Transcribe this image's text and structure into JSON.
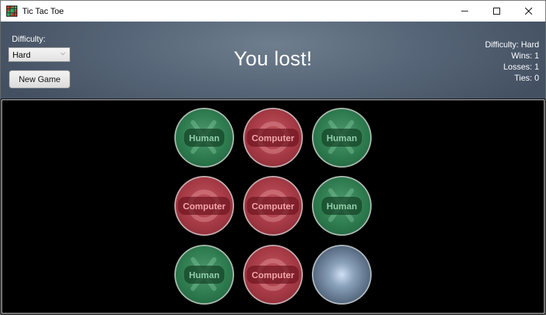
{
  "window": {
    "title": "Tic Tac Toe"
  },
  "header": {
    "difficulty_label": "Difficulty:",
    "difficulty_value": "Hard",
    "new_game_label": "New Game",
    "status_message": "You lost!",
    "stats": {
      "difficulty": "Difficulty: Hard",
      "wins": "Wins: 1",
      "losses": "Losses: 1",
      "ties": "Ties: 0"
    }
  },
  "board": {
    "cells": [
      {
        "owner": "human",
        "label": "Human",
        "mark": "X"
      },
      {
        "owner": "computer",
        "label": "Computer",
        "mark": "O"
      },
      {
        "owner": "human",
        "label": "Human",
        "mark": "X"
      },
      {
        "owner": "computer",
        "label": "Computer",
        "mark": "O"
      },
      {
        "owner": "computer",
        "label": "Computer",
        "mark": "O"
      },
      {
        "owner": "human",
        "label": "Human",
        "mark": "X"
      },
      {
        "owner": "human",
        "label": "Human",
        "mark": "X"
      },
      {
        "owner": "computer",
        "label": "Computer",
        "mark": "O"
      },
      {
        "owner": "empty",
        "label": "",
        "mark": ""
      }
    ]
  },
  "colors": {
    "human": "#2d7a4e",
    "computer": "#a43944",
    "empty": "#56697f",
    "header": "#566577"
  }
}
